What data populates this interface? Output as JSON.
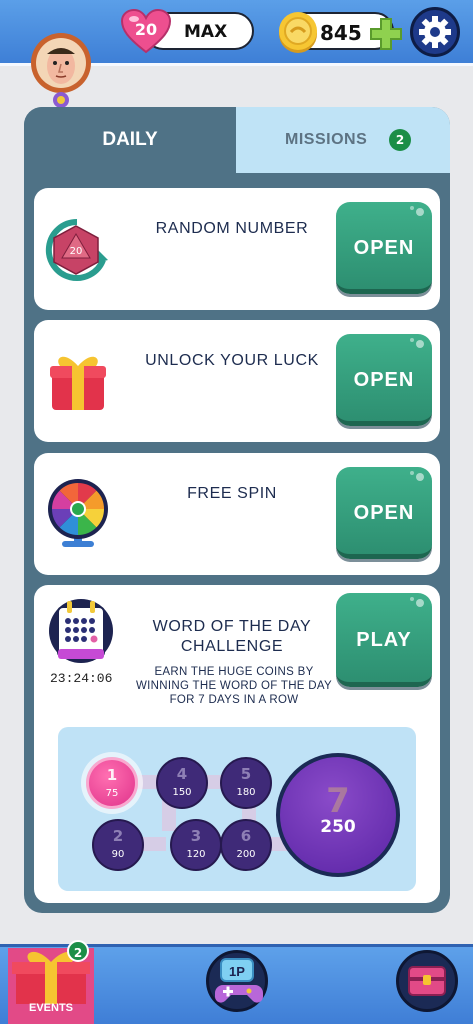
{
  "header": {
    "lives": "20",
    "lives_label": "MAX",
    "coins": "845"
  },
  "tabs": {
    "daily": "DAILY",
    "missions": "MISSIONS",
    "missions_badge": "2"
  },
  "cards": [
    {
      "title": "RANDOM NUMBER",
      "button": "OPEN",
      "icon": "d20-dice-icon"
    },
    {
      "title": "UNLOCK YOUR LUCK",
      "button": "OPEN",
      "icon": "gift-box-icon"
    },
    {
      "title": "FREE SPIN",
      "button": "OPEN",
      "icon": "prize-wheel-icon"
    }
  ],
  "wotd": {
    "title_line1": "WORD OF THE DAY",
    "title_line2": "CHALLENGE",
    "button": "PLAY",
    "timer": "23:24:06",
    "desc_line1": "EARN THE HUGE COINS BY",
    "desc_line2": "WINNING THE WORD OF THE DAY",
    "desc_line3": "FOR 7 DAYS IN A ROW",
    "days": [
      {
        "label": "1",
        "reward": "75"
      },
      {
        "label": "2",
        "reward": "90"
      },
      {
        "label": "3",
        "reward": "120"
      },
      {
        "label": "4",
        "reward": "150"
      },
      {
        "label": "5",
        "reward": "180"
      },
      {
        "label": "6",
        "reward": "200"
      },
      {
        "label": "7",
        "reward": "250"
      }
    ]
  },
  "bottom_nav": {
    "events_label": "EVENTS",
    "events_badge": "2",
    "play_mode_label": "1P"
  },
  "colors": {
    "top_bar": "#3e7fd6",
    "panel": "#4f7286",
    "missions_tab": "#bfe3f6",
    "green_button": "#3fb08b",
    "badge_green": "#1b8e47",
    "active_day": "#e0338b",
    "inactive_day": "#3f2a78"
  }
}
